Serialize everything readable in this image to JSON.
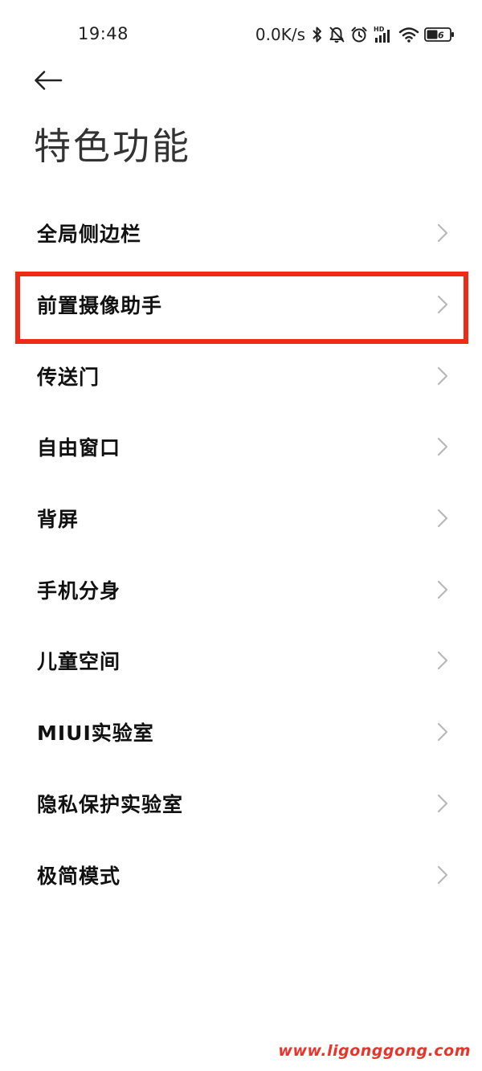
{
  "status_bar": {
    "time": "19:48",
    "net_speed": "0.0K/s",
    "hd_label": "HD",
    "battery_level": "46",
    "icons": [
      "bluetooth-icon",
      "mute-bell-icon",
      "alarm-icon",
      "signal-icon",
      "wifi-icon",
      "battery-icon"
    ]
  },
  "header": {
    "back_icon": "arrow-left-icon",
    "title": "特色功能"
  },
  "menu": {
    "items": [
      {
        "label": "全局侧边栏"
      },
      {
        "label": "前置摄像助手"
      },
      {
        "label": "传送门"
      },
      {
        "label": "自由窗口"
      },
      {
        "label": "背屏"
      },
      {
        "label": "手机分身"
      },
      {
        "label": "儿童空间"
      },
      {
        "label": "MIUI实验室"
      },
      {
        "label": "隐私保护实验室"
      },
      {
        "label": "极简模式"
      }
    ]
  },
  "highlight": {
    "color": "#ee2b14",
    "target_index": 1
  },
  "watermark": {
    "text": "www.ligonggong.com",
    "color": "#e8342c"
  }
}
